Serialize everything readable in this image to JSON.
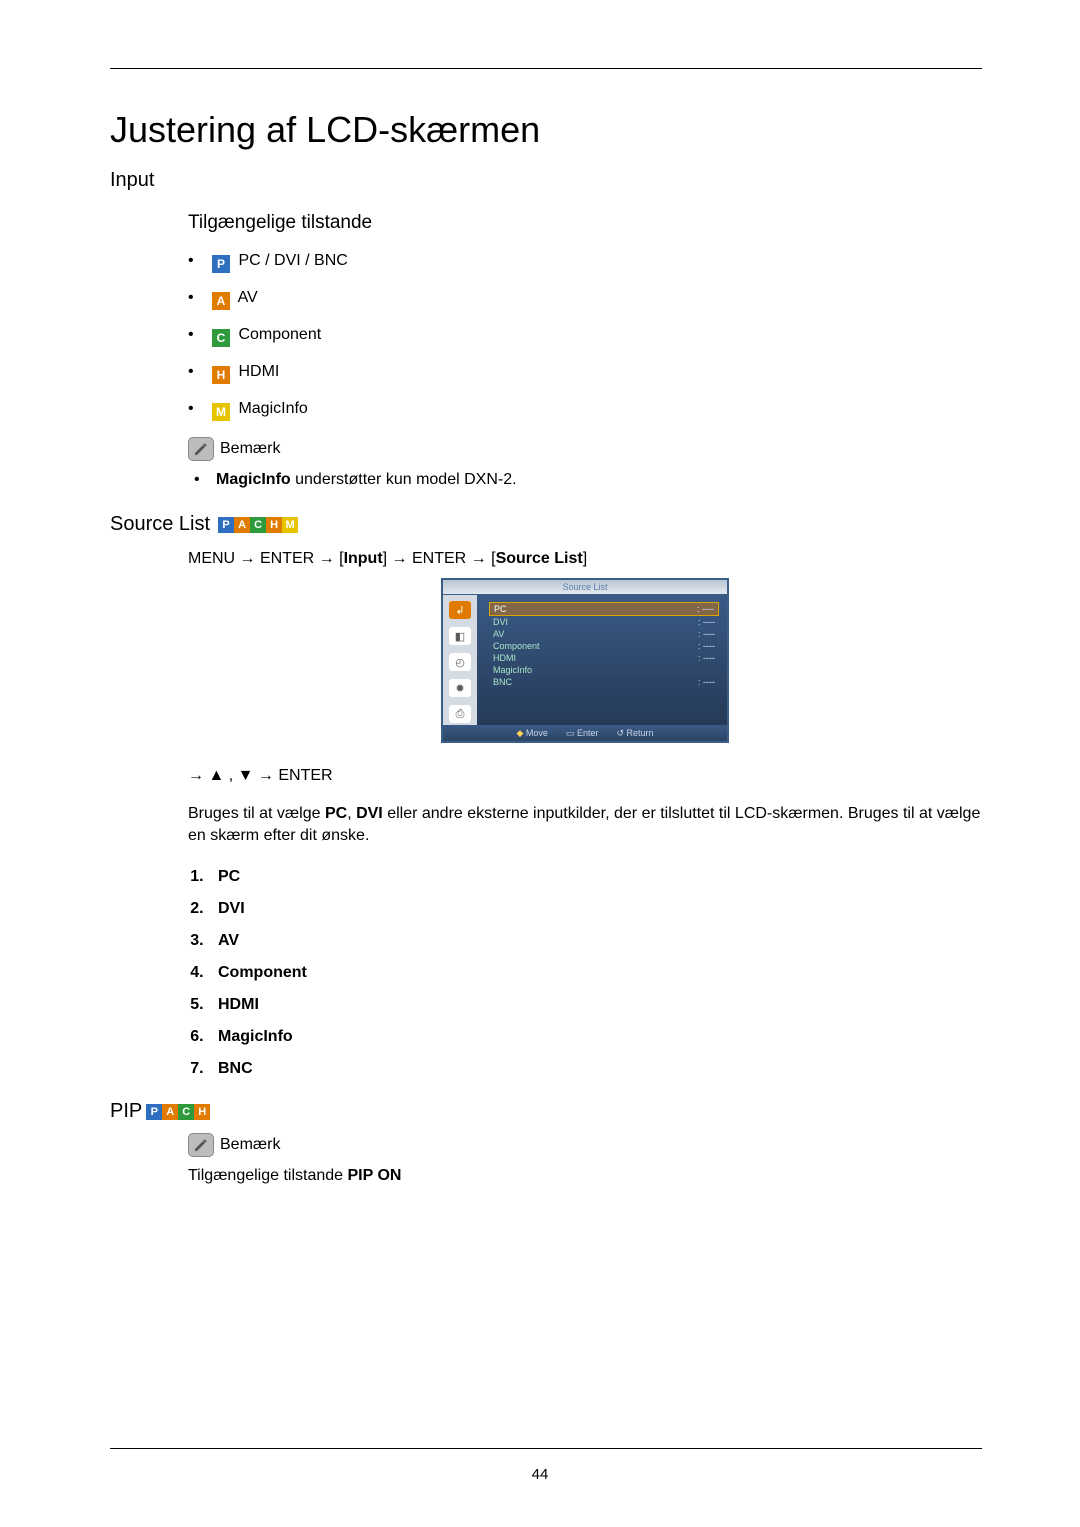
{
  "page_number": "44",
  "title": "Justering af LCD-skærmen",
  "sections": {
    "input_heading": "Input",
    "available_modes_heading": "Tilgængelige tilstande",
    "modes": [
      {
        "code": "P",
        "label": "PC / DVI / BNC"
      },
      {
        "code": "A",
        "label": "AV"
      },
      {
        "code": "C",
        "label": "Component"
      },
      {
        "code": "H",
        "label": "HDMI"
      },
      {
        "code": "M",
        "label": "MagicInfo"
      }
    ],
    "note_label": "Bemærk",
    "note_items": [
      {
        "bold": "MagicInfo",
        "rest": " understøtter kun model DXN-2."
      }
    ],
    "sourcelist_heading": "Source List",
    "sourcelist_icons": [
      "P",
      "A",
      "C",
      "H",
      "M"
    ],
    "menupath": {
      "p1": "MENU → ENTER → [",
      "b1": "Input",
      "p2": "] → ENTER → [",
      "b2": "Source List",
      "p3": "]"
    },
    "osd": {
      "title": "Source List",
      "items": [
        {
          "label": "PC",
          "value": "----",
          "selected": true
        },
        {
          "label": "DVI",
          "value": "----",
          "selected": false
        },
        {
          "label": "AV",
          "value": "----",
          "selected": false
        },
        {
          "label": "Component",
          "value": "----",
          "selected": false
        },
        {
          "label": "HDMI",
          "value": "----",
          "selected": false
        },
        {
          "label": "MagicInfo",
          "value": "",
          "selected": false
        },
        {
          "label": "BNC",
          "value": "----",
          "selected": false
        }
      ],
      "footer": {
        "move": "Move",
        "enter": "Enter",
        "return": "Return"
      }
    },
    "nav_line": "→ ▲ , ▼ → ENTER",
    "body_text": {
      "p1a": "Bruges til at vælge ",
      "b1": "PC",
      "p1b": ", ",
      "b2": "DVI",
      "p1c": " eller andre eksterne inputkilder, der er tilsluttet til LCD-skærmen. Bruges til at vælge en skærm efter dit ønske."
    },
    "source_order": [
      "PC",
      "DVI",
      "AV",
      "Component",
      "HDMI",
      "MagicInfo",
      "BNC"
    ],
    "pip_heading": "PIP",
    "pip_icons": [
      "P",
      "A",
      "C",
      "H"
    ],
    "pip_note_label": "Bemærk",
    "pip_note_text_a": "Tilgængelige tilstande ",
    "pip_note_text_b": "PIP ON"
  }
}
